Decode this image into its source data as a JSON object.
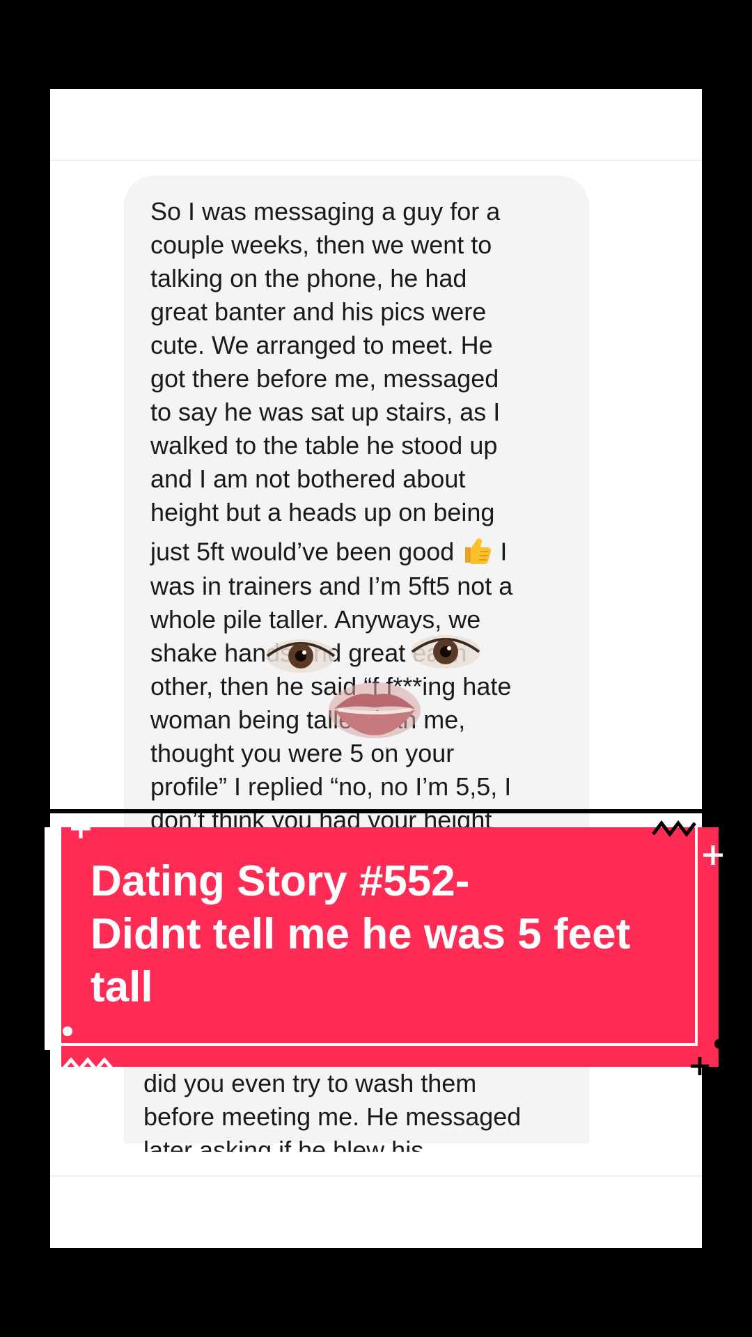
{
  "post": {
    "message_lines": [
      "So I was messaging a guy for a",
      "couple weeks, then we went to",
      "talking on the phone, he had",
      "great banter and his pics were",
      "cute. We arranged to meet. He",
      "got there before me, messaged",
      "to say he was sat up stairs, as I",
      "walked to the table he stood up",
      "and I am not bothered about",
      "height but a heads up on being",
      "just 5ft would’ve been good",
      "I",
      "was in trainers and I’m 5ft5 not a",
      "whole pile taller. Anyways, we",
      "shake hands and great each",
      "other, then he said “f f***ing hate",
      "woman being taller than me,",
      "thought you were 5 on your",
      "profile” I replied “no, no I’m 5,5, I",
      "don’t think you had your height"
    ],
    "bottom_lines": [
      "did you even try to wash them",
      "before meeting me. He messaged",
      "later asking if he blew his"
    ],
    "thumbs_emoji": "thumbs-up-emoji"
  },
  "title_card": {
    "title_lines": [
      "Dating Story #552-",
      "Didnt tell me he was 5 feet",
      "tall"
    ],
    "background_color": "#fe2c55",
    "text_color": "#ffffff"
  },
  "colors": {
    "bubble": "#f4f4f4",
    "page": "#ffffff",
    "frame": "#000000"
  }
}
